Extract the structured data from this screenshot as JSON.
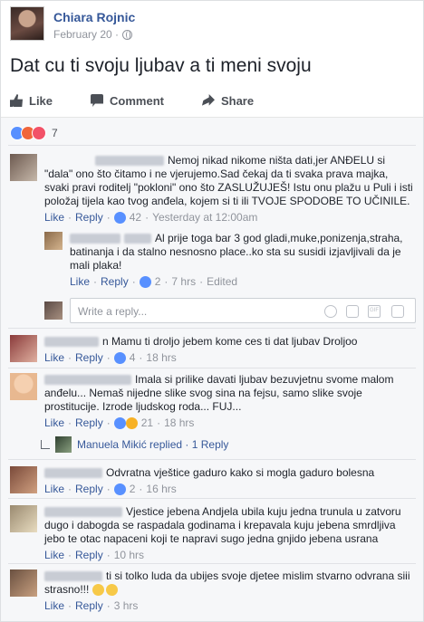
{
  "post": {
    "author": "Chiara Rojnic",
    "date": "February 20 · ",
    "text": "Dat cu ti svoju ljubav a ti meni svoju",
    "actions": {
      "like": "Like",
      "comment": "Comment",
      "share": "Share"
    },
    "reaction_count": "7"
  },
  "comments": [
    {
      "text": "Nemoj nikad nikome ništa dati,jer ANĐELU si \"dala\" ono što čitamo i ne vjerujemo.Sad čekaj da ti svaka prava majka, svaki pravi roditelj \"pokloni\" ono što ZASLUŽUJEŠ! Istu onu plažu u Puli i isti položaj tijela kao tvog anđela, kojem si ti ili TVOJE SPODOBE TO UČINILE.",
      "like": "Like",
      "reply": "Reply",
      "likes": "42",
      "time": "Yesterday at 12:00am"
    },
    {
      "text": "Al prije toga bar 3 god gladi,muke,ponizenja,straha, batinanja i da stalno nesnosno place..ko sta su susidi izjavljivali da je mali plaka!",
      "like": "Like",
      "reply": "Reply",
      "likes": "2",
      "time": "7 hrs",
      "edited": "Edited"
    },
    {
      "text": "n Mamu ti droljo jebem kome ces ti dat ljubav Droljoo",
      "like": "Like",
      "reply": "Reply",
      "likes": "4",
      "time": "18 hrs"
    },
    {
      "text": "Imala si prilike davati ljubav bezuvjetnu svome malom anđelu... Nemaš nijedne slike svog sina na fejsu, samo slike svoje prostitucije. Izrode ljudskog roda... FUJ...",
      "like": "Like",
      "reply": "Reply",
      "likes": "21",
      "time": "18 hrs"
    },
    {
      "text": "Odvratna vještice gaduro kako si mogla gaduro bolesna",
      "like": "Like",
      "reply": "Reply",
      "likes": "2",
      "time": "16 hrs"
    },
    {
      "text": "Vjestice jebena Andjela ubila kuju jedna trunula u zatvoru dugo i dabogda se raspadala godinama i krepavala kuju jebena smrdljiva jebo te otac napaceni koji te napravi sugo jedna gnjido jebena usrana",
      "like": "Like",
      "reply": "Reply",
      "time": "10 hrs"
    },
    {
      "text": "ti si tolko luda da ubijes svoje djetee mislim stvarno odvrana siii strasno!!!",
      "like": "Like",
      "reply": "Reply",
      "time": "3 hrs"
    }
  ],
  "reply_box": {
    "placeholder": "Write a reply..."
  },
  "replied": {
    "name": "Manuela Mikić",
    "text": " replied",
    "count": "1 Reply"
  },
  "colors": {
    "link": "#365899",
    "meta": "#90949c",
    "bg": "#f6f7f9"
  }
}
